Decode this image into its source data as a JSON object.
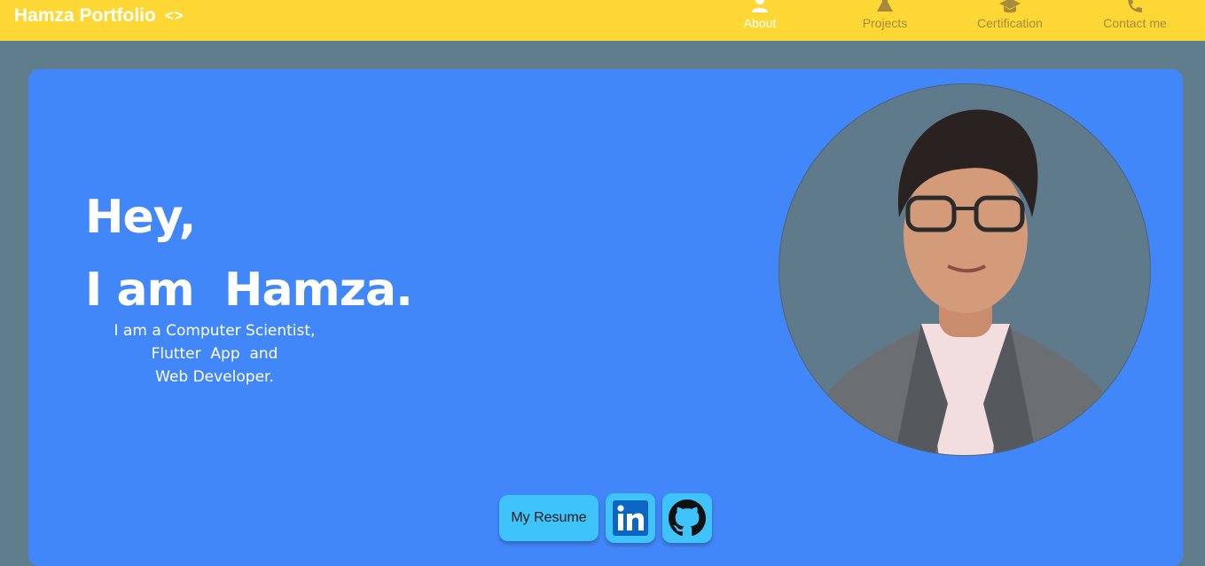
{
  "header": {
    "brand": "Hamza Portfolio",
    "brand_icon": "code-icon",
    "brand_glyph": "<>",
    "nav": [
      {
        "label": "About",
        "icon": "person-icon",
        "active": true
      },
      {
        "label": "Projects",
        "icon": "flask-icon",
        "active": false
      },
      {
        "label": "Certification",
        "icon": "graduation-cap-icon",
        "active": false
      },
      {
        "label": "Contact me",
        "icon": "phone-icon",
        "active": false
      }
    ]
  },
  "hero": {
    "line1": "Hey,",
    "line2": "I am  Hamza.",
    "tagline1": "I am a Computer Scientist,",
    "tagline2": "Flutter  App  and",
    "tagline3": "Web Developer.",
    "resume_label": "My Resume",
    "linkedin_icon": "linkedin-icon",
    "github_icon": "github-icon",
    "avatar": "profile-photo"
  },
  "colors": {
    "appbar": "#fdd835",
    "page_bg": "#607d8b",
    "card_bg": "#4287f9",
    "button_bg": "#3ec3fa"
  }
}
